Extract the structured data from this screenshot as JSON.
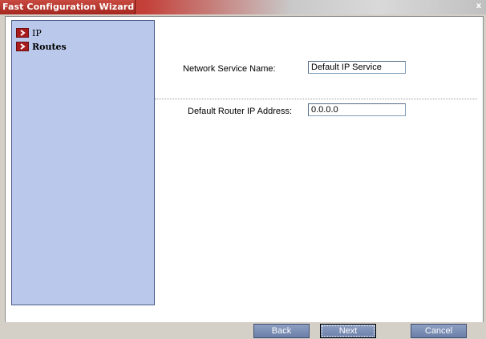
{
  "window": {
    "title": "Fast Configuration Wizard",
    "close_glyph": "x"
  },
  "nav": {
    "items": [
      {
        "label": "IP",
        "icon": "chevron-right-icon",
        "bold": false
      },
      {
        "label": "Routes",
        "icon": "chevron-right-icon",
        "bold": true
      }
    ]
  },
  "form": {
    "network_service_name": {
      "label": "Network Service Name:",
      "value": "Default IP Service"
    },
    "default_router_ip": {
      "label": "Default Router IP Address:",
      "value": "0.0.0.0"
    }
  },
  "buttons": {
    "back": "Back",
    "next": "Next",
    "cancel": "Cancel"
  },
  "colors": {
    "title_bar": "#b8322a",
    "nav_panel": "#b9c8eb",
    "nav_arrow": "#a91c1e",
    "button": "#7b8db3"
  }
}
